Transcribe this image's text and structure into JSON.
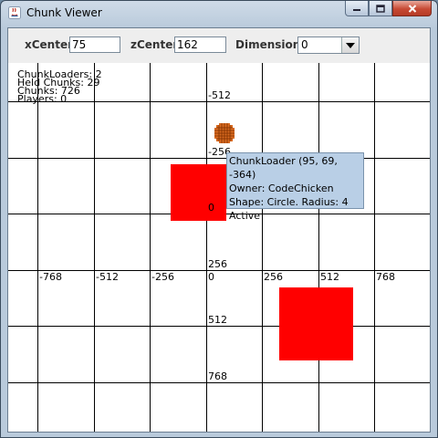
{
  "window": {
    "title": "Chunk Viewer",
    "controls": [
      "minimize-icon",
      "maximize-icon",
      "close-icon"
    ]
  },
  "toolbar": {
    "xcenter_label": "xCenter",
    "xcenter_value": "75",
    "zcenter_label": "zCenter",
    "zcenter_value": "162",
    "dimension_label": "Dimension",
    "dimension_value": "0"
  },
  "stats": {
    "chunkloaders": "ChunkLoaders: 2",
    "held_chunks": "Held Chunks: 29",
    "chunks": "Chunks: 726",
    "players": "Players: 0"
  },
  "grid": {
    "x_ticks": [
      "-768",
      "-512",
      "-256",
      "0",
      "256",
      "512",
      "768"
    ],
    "z_ticks": [
      "-512",
      "-256",
      "0",
      "256",
      "512",
      "768"
    ]
  },
  "tooltip": {
    "line1": "ChunkLoader (95, 69, -364)",
    "line2": "Owner: CodeChicken",
    "line3": "Shape: Circle. Radius: 4",
    "line4": "Active"
  },
  "colors": {
    "held_chunk": "#ff0000",
    "chunkloader": "#cc5500",
    "tooltip_bg": "#b9cfe6"
  }
}
